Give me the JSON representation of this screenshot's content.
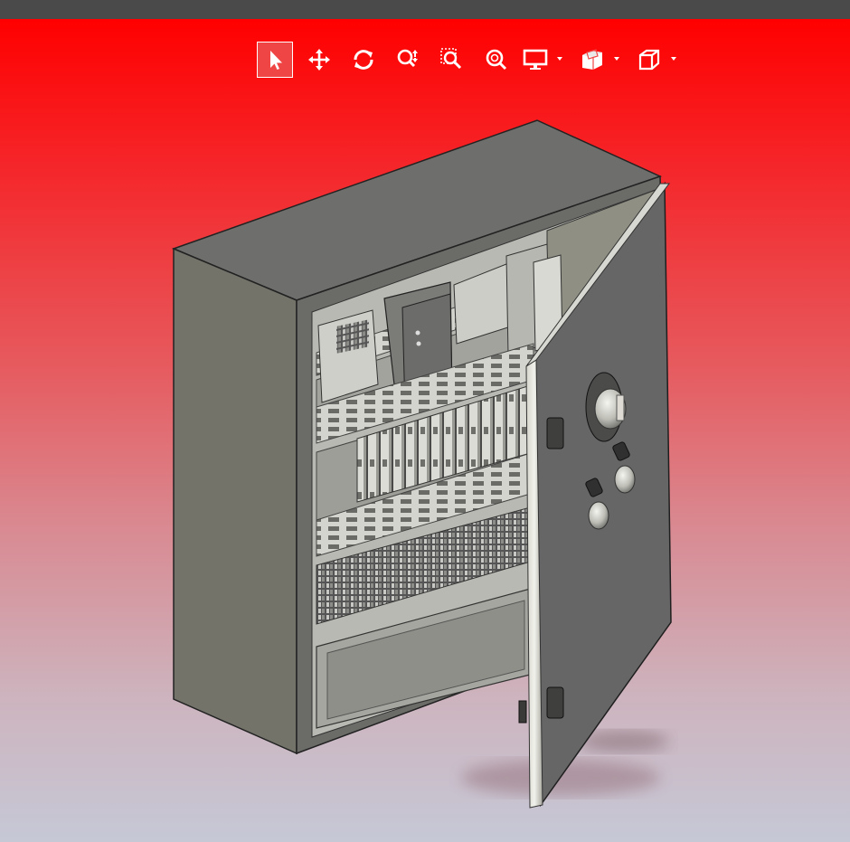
{
  "app": {
    "window_title": ""
  },
  "toolbar": {
    "items": [
      {
        "id": "select",
        "icon": "pointer-arrow-icon",
        "active": true,
        "dropdown": false
      },
      {
        "id": "pan",
        "icon": "move-arrows-icon",
        "active": false,
        "dropdown": false
      },
      {
        "id": "rotate",
        "icon": "rotate-icon",
        "active": false,
        "dropdown": false
      },
      {
        "id": "zoom-updown",
        "icon": "zoom-updown-icon",
        "active": false,
        "dropdown": false
      },
      {
        "id": "zoom-window",
        "icon": "zoom-window-icon",
        "active": false,
        "dropdown": false
      },
      {
        "id": "zoom-fit",
        "icon": "zoom-fit-icon",
        "active": false,
        "dropdown": false
      },
      {
        "id": "display-mode",
        "icon": "monitor-icon",
        "active": false,
        "dropdown": true
      },
      {
        "id": "section-view",
        "icon": "section-cube-icon",
        "active": false,
        "dropdown": true
      },
      {
        "id": "view-orientation",
        "icon": "cube-outline-icon",
        "active": false,
        "dropdown": true
      }
    ]
  },
  "colors": {
    "background_top": "#ff0000",
    "background_bottom": "#c6c8d6",
    "enclosure_body": "#6e6e6a",
    "enclosure_side": "#747468",
    "door": "#666666",
    "toolbar_active": "#ef4545",
    "icon": "#ffffff"
  },
  "model": {
    "name": "electrical-enclosure-with-open-door"
  }
}
